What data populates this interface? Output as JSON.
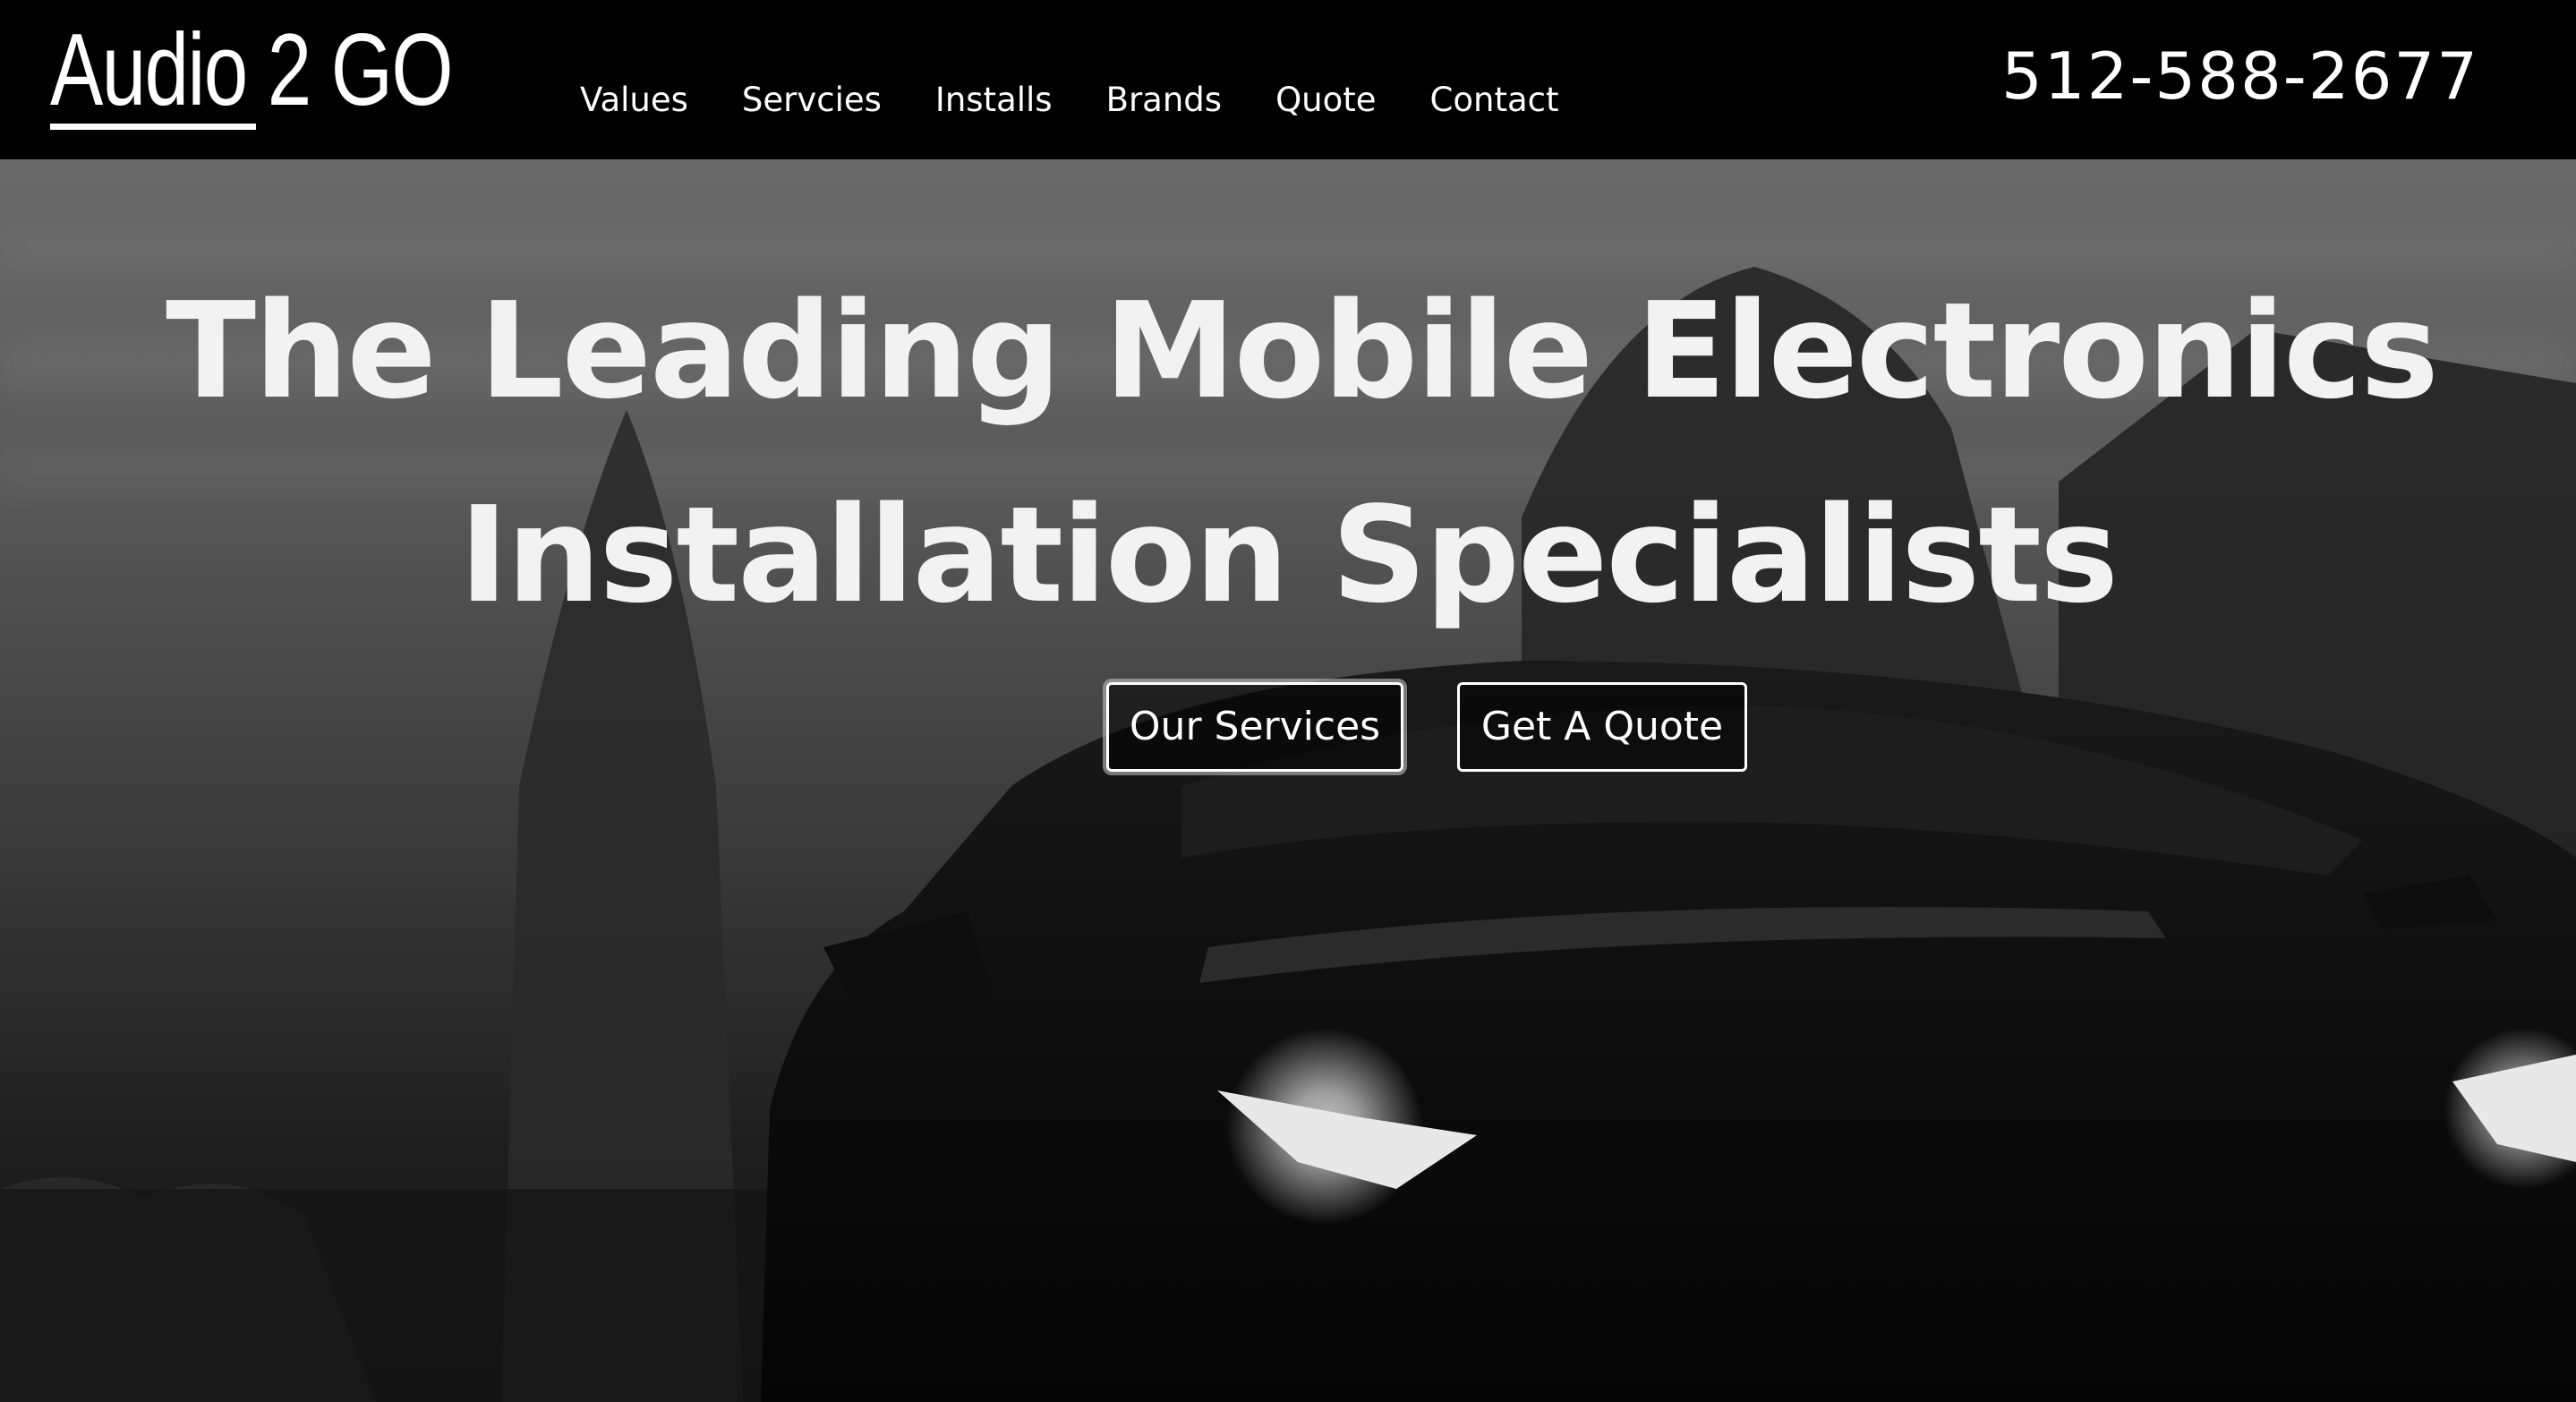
{
  "header": {
    "logo": "Audio 2 GO",
    "nav": [
      {
        "label": "Values"
      },
      {
        "label": "Servcies"
      },
      {
        "label": "Installs"
      },
      {
        "label": "Brands"
      },
      {
        "label": "Quote"
      },
      {
        "label": "Contact"
      }
    ],
    "phone": "512-588-2677"
  },
  "hero": {
    "headline_line1": "The Leading Mobile Electronics",
    "headline_line2": "Installation Specialists",
    "buttons": {
      "services": "Our Services",
      "quote": "Get A Quote"
    }
  },
  "colors": {
    "header_bg": "#000000",
    "text": "#ffffff"
  }
}
